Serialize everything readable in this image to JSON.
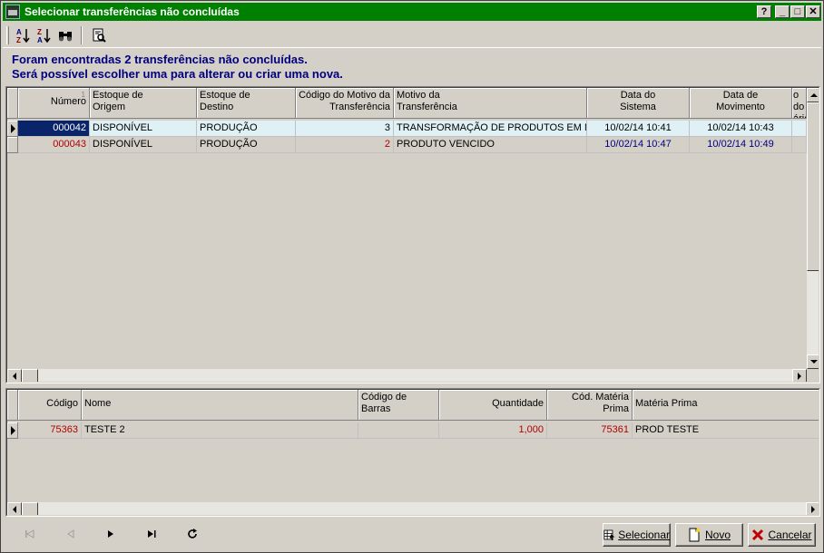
{
  "window": {
    "title": "Selecionar transferências não concluídas",
    "help_label": "?",
    "minimize_label": "_",
    "maximize_label": "□",
    "close_label": "✕"
  },
  "toolbar": {
    "sort_asc_label": "A↓Z",
    "sort_desc_label": "Z↓A",
    "find_label": "🔍",
    "preview_label": "🗎"
  },
  "message": {
    "line1": "Foram encontradas 2 transferências não concluídas.",
    "line2": "Será possível escolher uma para alterar ou criar uma nova."
  },
  "transfers": {
    "headers": {
      "numero": "Número",
      "numero_idx": "1",
      "estoque_origem": "Estoque de\nOrigem",
      "estoque_destino": "Estoque de\nDestino",
      "codigo_motivo": "Código do Motivo da\nTransferência",
      "motivo": "Motivo da\nTransferência",
      "data_sistema": "Data do\nSistema",
      "data_movimento": "Data de\nMovimento",
      "usuario": "o do\nário"
    },
    "rows": [
      {
        "numero": "000042",
        "estoque_origem": "DISPONÍVEL",
        "estoque_destino": "PRODUÇÃO",
        "codigo_motivo": "3",
        "motivo": "TRANSFORMAÇÃO DE PRODUTOS EM M",
        "data_sistema": "10/02/14 10:41",
        "data_movimento": "10/02/14 10:43"
      },
      {
        "numero": "000043",
        "estoque_origem": "DISPONÍVEL",
        "estoque_destino": "PRODUÇÃO",
        "codigo_motivo": "2",
        "motivo": "PRODUTO VENCIDO",
        "data_sistema": "10/02/14 10:47",
        "data_movimento": "10/02/14 10:49"
      }
    ]
  },
  "items": {
    "headers": {
      "codigo": "Código",
      "nome": "Nome",
      "codigo_barras": "Código de\nBarras",
      "quantidade": "Quantidade",
      "cod_materia_prima": "Cód. Matéria\nPrima",
      "materia_prima": "Matéria Prima"
    },
    "rows": [
      {
        "codigo": "75363",
        "nome": "TESTE 2",
        "codigo_barras": "",
        "quantidade": "1,000",
        "cod_materia_prima": "75361",
        "materia_prima": "PROD TESTE"
      }
    ]
  },
  "navigation": {
    "first": "⏮",
    "prior": "◁",
    "next": "▶",
    "last": "⏭",
    "refresh": "↻"
  },
  "buttons": {
    "selecionar": "Selecionar",
    "novo": "Novo",
    "cancelar": "Cancelar"
  },
  "colors": {
    "title_bar": "#008000",
    "message_text": "#000080",
    "selected_row": "#dff1f5",
    "number_red": "#b00000",
    "date_blue": "#000080"
  }
}
